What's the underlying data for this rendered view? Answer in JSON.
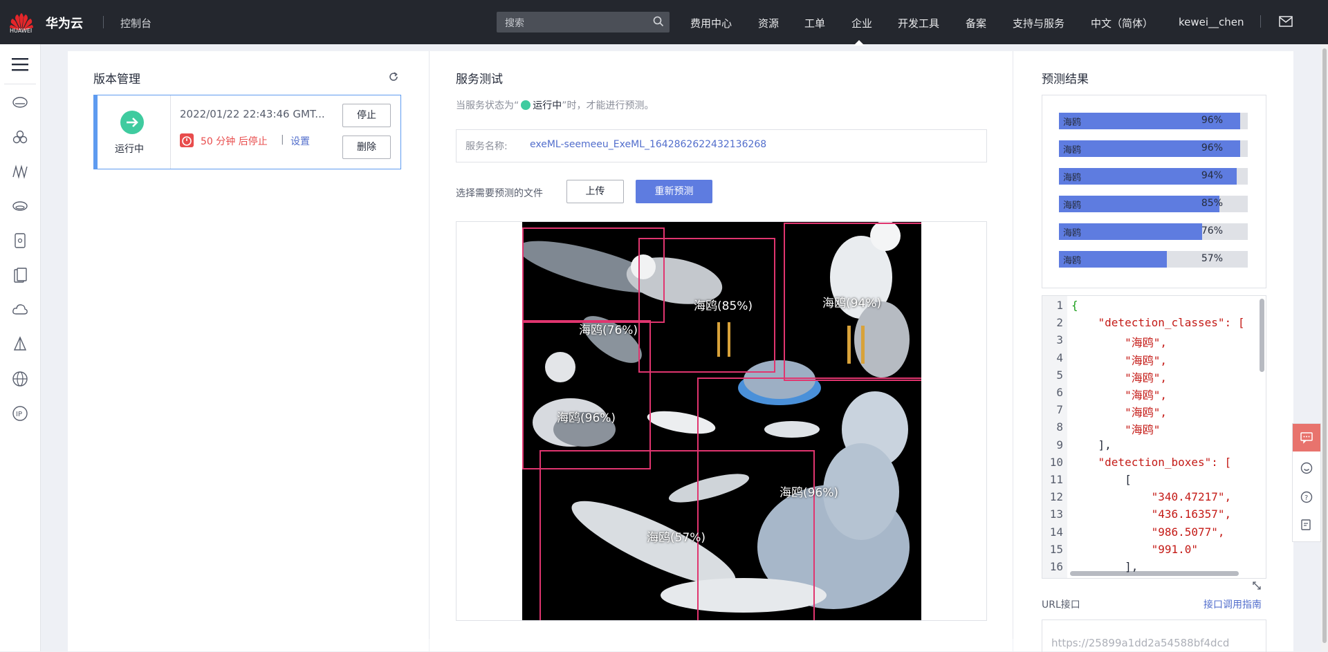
{
  "header": {
    "logo_text": "HUAWEI",
    "brand": "华为云",
    "console": "控制台",
    "search_placeholder": "搜索",
    "nav": [
      "费用中心",
      "资源",
      "工单",
      "企业",
      "开发工具",
      "备案",
      "支持与服务",
      "中文（简体）",
      "kewei__chen"
    ]
  },
  "sidebar": {
    "icons": [
      "menu-icon",
      "storage-icon",
      "compute-icon",
      "monitor-icon",
      "database-icon",
      "container-icon",
      "document-icon",
      "cloud-icon",
      "ai-icon",
      "globe-icon",
      "ip-icon"
    ]
  },
  "version": {
    "title": "版本管理",
    "status": "运行中",
    "datetime": "2022/01/22 22:43:46 GMT...",
    "timer_text": "50 分钟 后停止",
    "separator": "|",
    "settings": "设置",
    "stop": "停止",
    "delete": "删除"
  },
  "service_test": {
    "title": "服务测试",
    "hint_prefix": "当服务状态为“",
    "hint_status": "运行中",
    "hint_suffix": "”时，才能进行预测。",
    "service_label": "服务名称:",
    "service_name": "exeML-seemeeu_ExeML_1642862622432136268",
    "file_label": "选择需要预测的文件",
    "upload": "上传",
    "repredict": "重新预测",
    "detections": [
      {
        "label": "海鸥(96%)"
      },
      {
        "label": "海鸥(96%)"
      },
      {
        "label": "海鸥(94%)"
      },
      {
        "label": "海鸥(85%)"
      },
      {
        "label": "海鸥(76%)"
      },
      {
        "label": "海鸥(57%)"
      }
    ]
  },
  "results": {
    "title": "预测结果",
    "items": [
      {
        "name": "海鸥",
        "pct": "96%",
        "value": 0.96
      },
      {
        "name": "海鸥",
        "pct": "96%",
        "value": 0.96
      },
      {
        "name": "海鸥",
        "pct": "94%",
        "value": 0.94
      },
      {
        "name": "海鸥",
        "pct": "85%",
        "value": 0.85
      },
      {
        "name": "海鸥",
        "pct": "76%",
        "value": 0.76
      },
      {
        "name": "海鸥",
        "pct": "57%",
        "value": 0.57
      }
    ],
    "code_lines": [
      {
        "n": "1",
        "t": "{"
      },
      {
        "n": "2",
        "t": "    \"detection_classes\": ["
      },
      {
        "n": "3",
        "t": "        \"海鸥\","
      },
      {
        "n": "4",
        "t": "        \"海鸥\","
      },
      {
        "n": "5",
        "t": "        \"海鸥\","
      },
      {
        "n": "6",
        "t": "        \"海鸥\","
      },
      {
        "n": "7",
        "t": "        \"海鸥\","
      },
      {
        "n": "8",
        "t": "        \"海鸥\""
      },
      {
        "n": "9",
        "t": "    ],"
      },
      {
        "n": "10",
        "t": "    \"detection_boxes\": ["
      },
      {
        "n": "11",
        "t": "        ["
      },
      {
        "n": "12",
        "t": "            \"340.47217\","
      },
      {
        "n": "13",
        "t": "            \"436.16357\","
      },
      {
        "n": "14",
        "t": "            \"986.5077\","
      },
      {
        "n": "15",
        "t": "            \"991.0\""
      },
      {
        "n": "16",
        "t": "        ],"
      }
    ],
    "url_label": "URL接口",
    "url_guide": "接口调用指南",
    "url_value": "https://25899a1dd2a54588bf4dcd"
  },
  "colors": {
    "primary": "#5e7ce0",
    "success": "#3fcb9f",
    "danger": "#e84c4c",
    "box": "#e0356f"
  }
}
